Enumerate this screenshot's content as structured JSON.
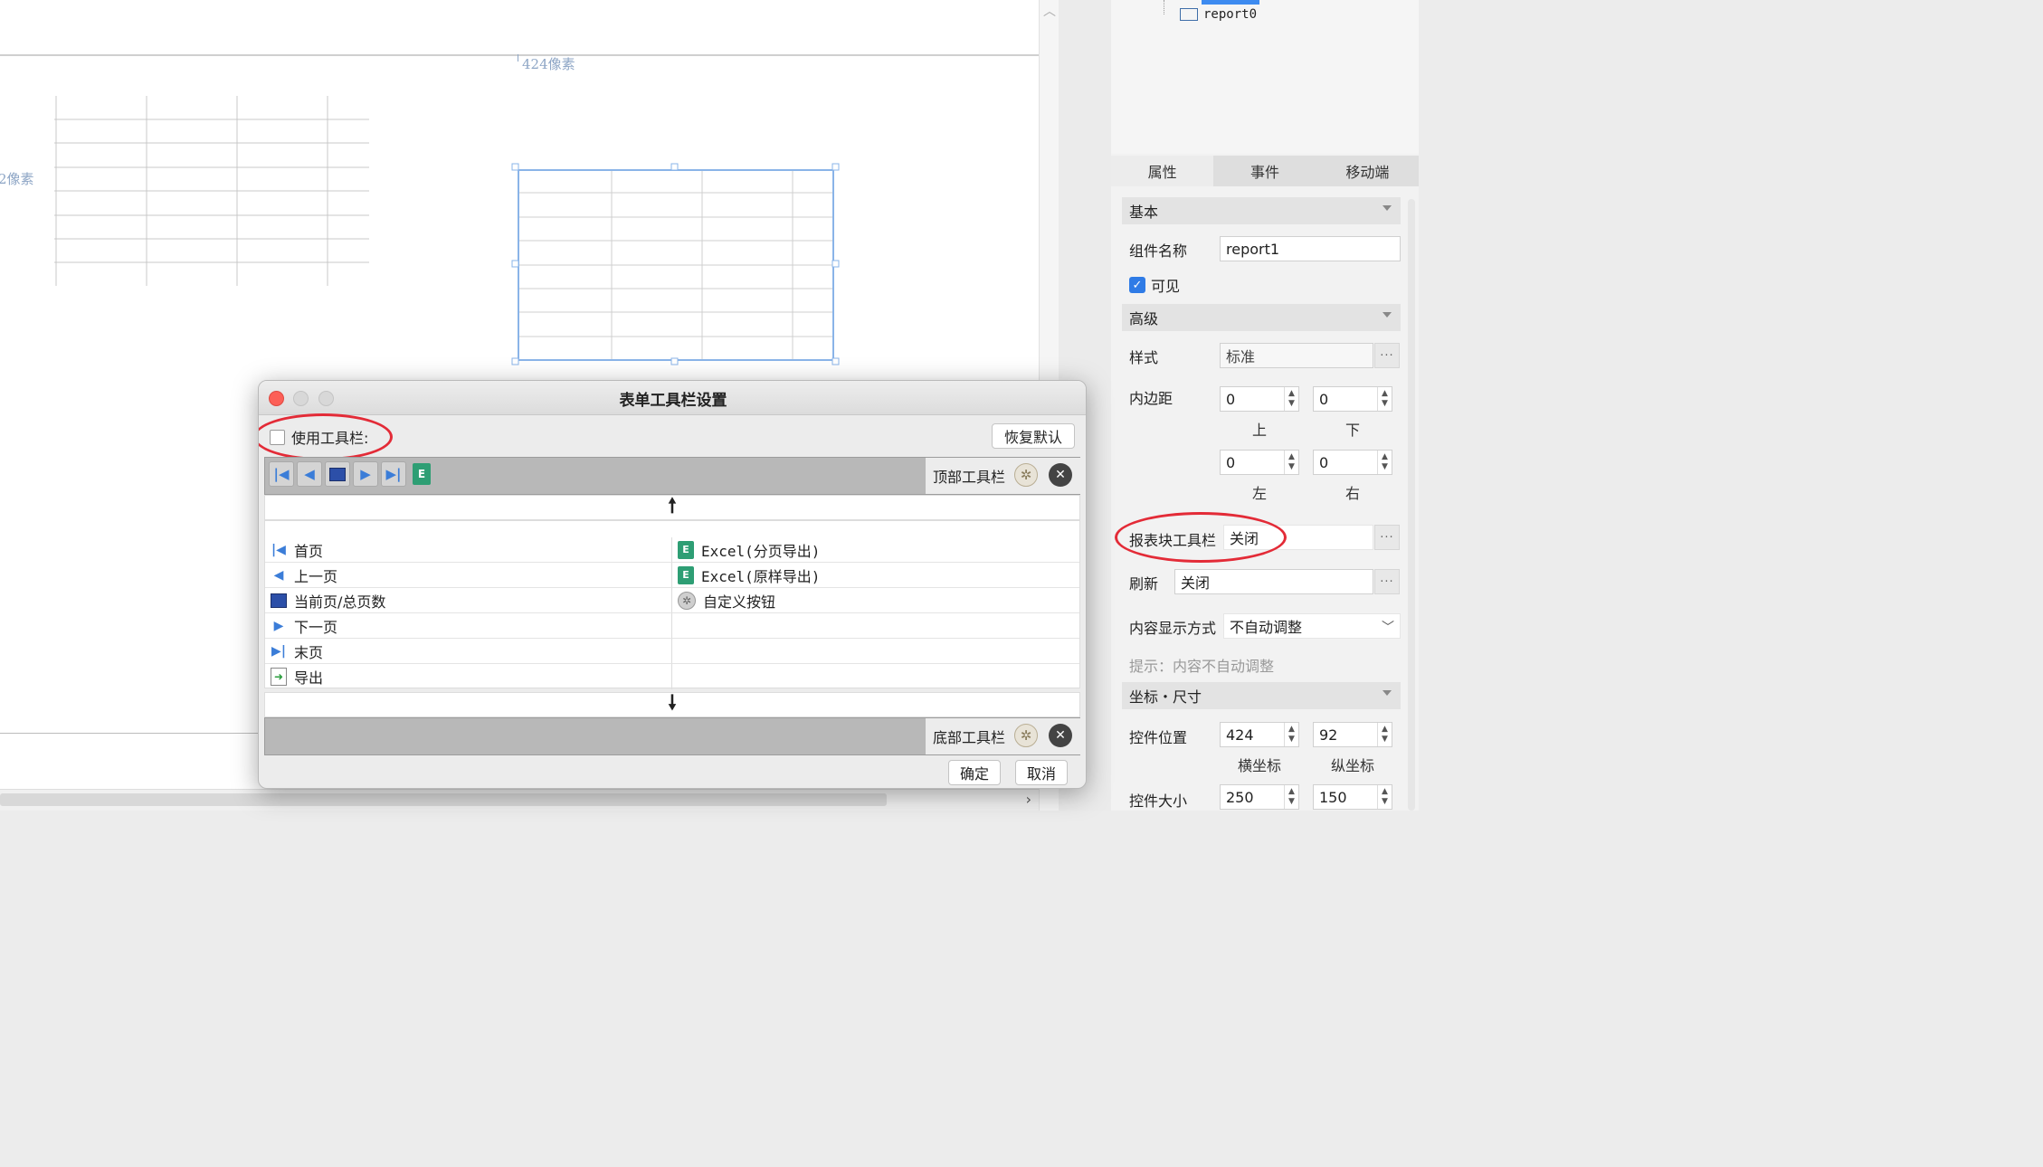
{
  "canvas": {
    "px_label_top": "424像素",
    "px_label_left": "2像素"
  },
  "tree": {
    "item": "report0"
  },
  "tabs": [
    {
      "label": "属性",
      "active": true
    },
    {
      "label": "事件",
      "active": false
    },
    {
      "label": "移动端",
      "active": false
    }
  ],
  "props": {
    "basic_section": "基本",
    "name_label": "组件名称",
    "name_value": "report1",
    "visible_label": "可见",
    "visible_checked": true,
    "advanced_section": "高级",
    "style_label": "样式",
    "style_value": "标准",
    "padding_label": "内边距",
    "padding": {
      "top": "0",
      "bottom": "0",
      "left": "0",
      "right": "0"
    },
    "padding_sub": {
      "top": "上",
      "bottom": "下",
      "left": "左",
      "right": "右"
    },
    "toolbar_label": "报表块工具栏",
    "toolbar_value": "关闭",
    "refresh_label": "刷新",
    "refresh_value": "关闭",
    "display_label": "内容显示方式",
    "display_value": "不自动调整",
    "hint": "提示：内容不自动调整",
    "coord_section": "坐标・尺寸",
    "pos_label": "控件位置",
    "pos_x": "424",
    "pos_y": "92",
    "pos_x_sub": "横坐标",
    "pos_y_sub": "纵坐标",
    "size_label": "控件大小",
    "size_w": "250",
    "size_h": "150"
  },
  "dialog": {
    "title": "表单工具栏设置",
    "use_toolbar_label": "使用工具栏:",
    "use_toolbar_checked": false,
    "restore_default": "恢复默认",
    "top_toolbar_label": "顶部工具栏",
    "bottom_toolbar_label": "底部工具栏",
    "items_left": [
      {
        "icon": "first-page-icon",
        "label": "首页"
      },
      {
        "icon": "prev-page-icon",
        "label": "上一页"
      },
      {
        "icon": "page-count-icon",
        "label": "当前页/总页数"
      },
      {
        "icon": "next-page-icon",
        "label": "下一页"
      },
      {
        "icon": "last-page-icon",
        "label": "末页"
      },
      {
        "icon": "export-icon",
        "label": "导出"
      }
    ],
    "items_right": [
      {
        "icon": "excel-icon",
        "label": "Excel(分页导出)"
      },
      {
        "icon": "excel-icon",
        "label": "Excel(原样导出)"
      },
      {
        "icon": "gear-icon",
        "label": "自定义按钮"
      }
    ],
    "ok": "确定",
    "cancel": "取消"
  },
  "colors": {
    "accent": "#3d8bf0",
    "highlight_oval": "#e32b37",
    "selection_border": "#8ab4e8"
  }
}
